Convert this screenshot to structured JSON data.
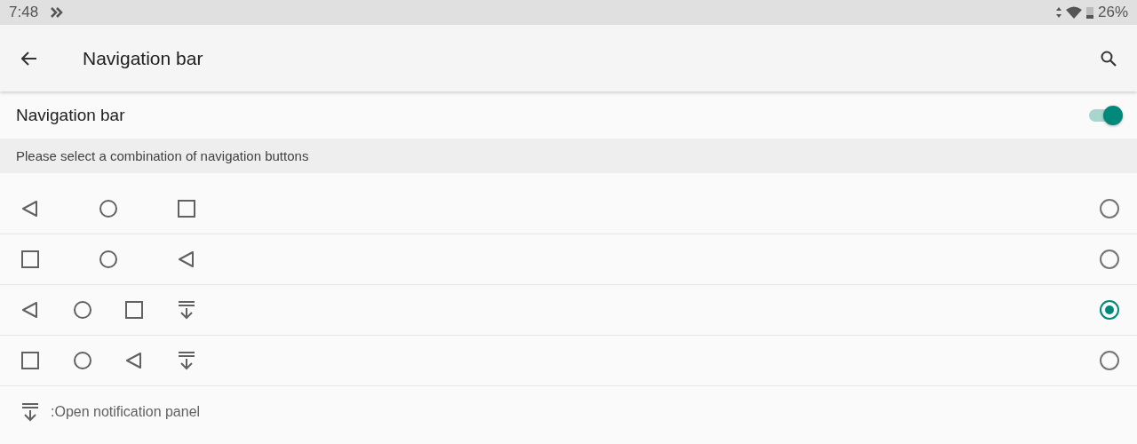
{
  "status_bar": {
    "time": "7:48",
    "battery": "26%"
  },
  "toolbar": {
    "title": "Navigation bar"
  },
  "switch": {
    "label": "Navigation bar",
    "on": true
  },
  "section": {
    "header": "Please select a combination of navigation buttons"
  },
  "options": [
    {
      "buttons": [
        {
          "kind": "back"
        },
        {
          "kind": "home"
        },
        {
          "kind": "recents"
        }
      ],
      "selected": false
    },
    {
      "buttons": [
        {
          "kind": "recents"
        },
        {
          "kind": "home"
        },
        {
          "kind": "back"
        }
      ],
      "selected": false
    },
    {
      "buttons": [
        {
          "kind": "back"
        },
        {
          "kind": "home"
        },
        {
          "kind": "recents"
        },
        {
          "kind": "notifications"
        }
      ],
      "selected": true
    },
    {
      "buttons": [
        {
          "kind": "recents"
        },
        {
          "kind": "home"
        },
        {
          "kind": "back"
        },
        {
          "kind": "notifications"
        }
      ],
      "selected": false
    }
  ],
  "legend": {
    "text": ":Open notification panel"
  }
}
